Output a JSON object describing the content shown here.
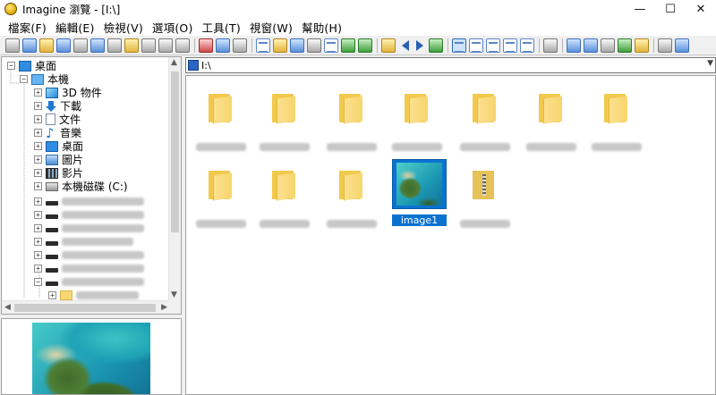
{
  "window": {
    "title": "Imagine 瀏覽 - [I:\\]",
    "minimize": "—",
    "maximize": "☐",
    "close": "✕"
  },
  "menu": [
    {
      "label": "檔案(F)"
    },
    {
      "label": "編輯(E)"
    },
    {
      "label": "檢視(V)"
    },
    {
      "label": "選項(O)"
    },
    {
      "label": "工具(T)"
    },
    {
      "label": "視窗(W)"
    },
    {
      "label": "幫助(H)"
    }
  ],
  "tree": {
    "items": [
      {
        "label": "桌面",
        "icon": "desktop-icon"
      },
      {
        "label": "本機",
        "icon": "computer-icon"
      },
      {
        "label": "3D 物件",
        "icon": "3d-objects-icon"
      },
      {
        "label": "下載",
        "icon": "download-icon"
      },
      {
        "label": "文件",
        "icon": "document-icon"
      },
      {
        "label": "音樂",
        "icon": "music-icon"
      },
      {
        "label": "桌面",
        "icon": "desktop-icon"
      },
      {
        "label": "圖片",
        "icon": "pictures-icon"
      },
      {
        "label": "影片",
        "icon": "videos-icon"
      },
      {
        "label": "本機磁碟 (C:)",
        "icon": "drive-icon"
      }
    ]
  },
  "address": {
    "path": "I:\\"
  },
  "files": {
    "selected_label": "image1"
  },
  "colors": {
    "selection": "#0b72d0",
    "folder": "#f2c94c"
  }
}
